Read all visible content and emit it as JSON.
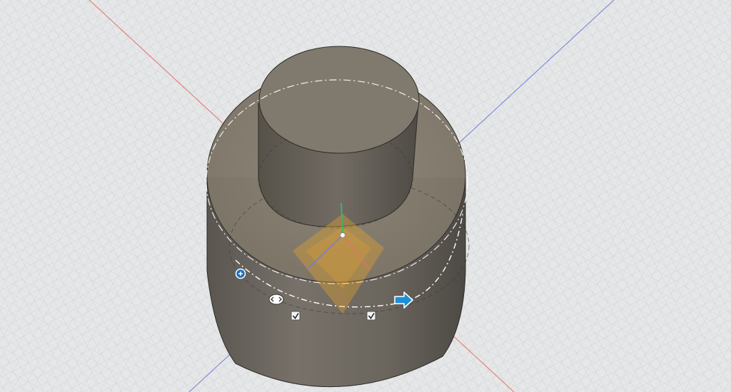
{
  "app": {
    "view": "3D viewport"
  },
  "colors": {
    "background": "#e6e7e8",
    "grid_minor": "#d3d5d7",
    "grid_major": "#bfc2c5",
    "x_axis": "#e0736b",
    "y_axis": "#6f7fd8",
    "z_axis": "#3cb36b",
    "body_fill": "#6f6a62",
    "body_side_dark": "#54504a",
    "body_top": "#8a8274",
    "manipulator": "#f0a826",
    "arrow_handle": "#1e8fd6",
    "selection_dash": "#ffffff"
  },
  "icons": {
    "move_arrow": "arrow-right-icon",
    "rotate_handle": "rotate-handle-icon",
    "scale_handle": "scale-handle-icon",
    "checkbox_left": "checkbox-checked-icon",
    "checkbox_right": "checkbox-checked-icon"
  },
  "checkboxes": {
    "left_checked": true,
    "right_checked": true
  }
}
